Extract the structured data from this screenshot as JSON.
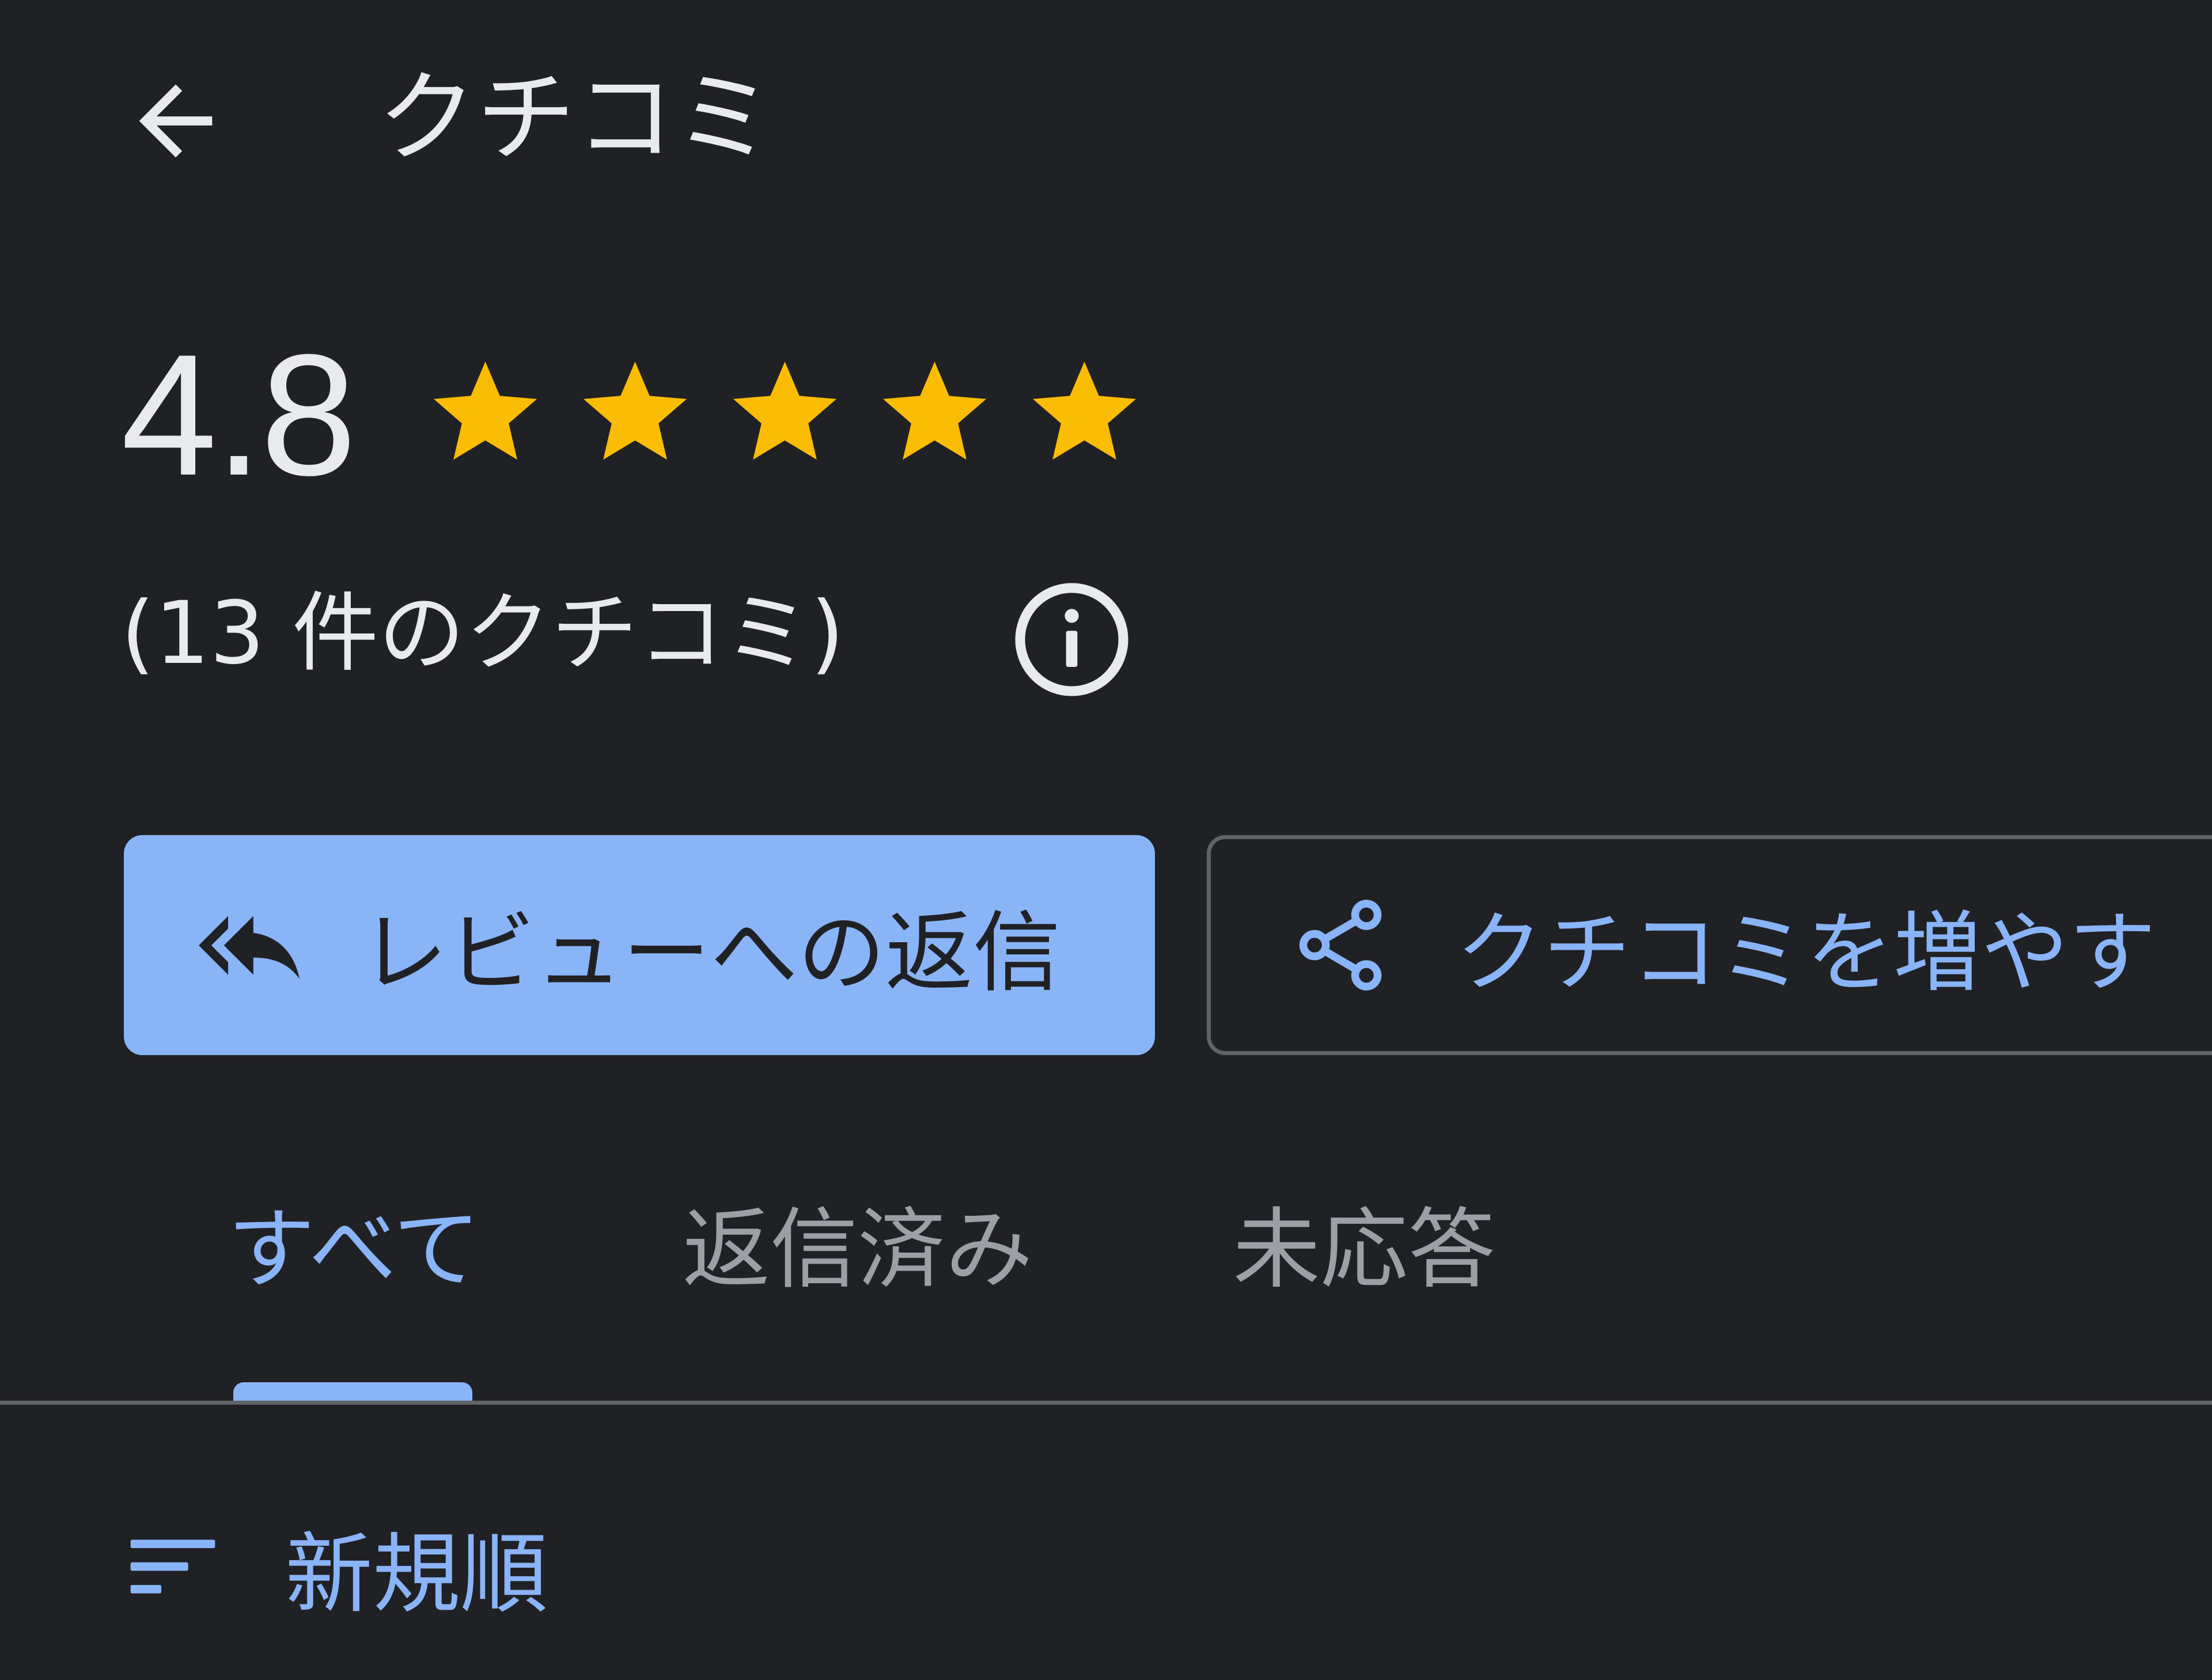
{
  "header": {
    "title": "クチコミ",
    "back_icon": "arrow-back-icon"
  },
  "rating": {
    "value": "4.8",
    "stars": 5,
    "star_color": "#fbbc04",
    "count_text": "(13 件のクチコミ)",
    "info_icon": "info-icon"
  },
  "actions": {
    "reply_label": "レビューへの返信",
    "reply_icon": "reply-all-icon",
    "grow_label": "クチコミを増やす",
    "grow_icon": "share-icon",
    "accent_color": "#8ab4f8"
  },
  "tabs": [
    {
      "label": "すべて",
      "selected": true
    },
    {
      "label": "返信済み",
      "selected": false
    },
    {
      "label": "未応答",
      "selected": false
    }
  ],
  "sort": {
    "label": "新規順",
    "icon": "sort-icon"
  }
}
